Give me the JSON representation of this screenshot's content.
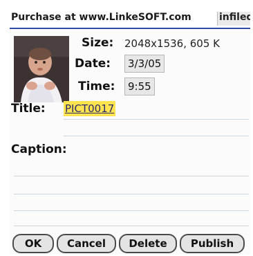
{
  "window": {
    "title": "Purchase at www.LinkeSOFT.com",
    "tab_label": "infiled"
  },
  "photo": {
    "description_icon": "photo-thumbnail"
  },
  "fields": {
    "size_label": "Size:",
    "size_value": "2048x1536, 605 K",
    "date_label": "Date:",
    "date_value": "3/3/05",
    "time_label": "Time:",
    "time_value": "9:55",
    "title_label": "Title:",
    "title_value": "PICT0017",
    "caption_label": "Caption:"
  },
  "buttons": {
    "ok": "OK",
    "cancel": "Cancel",
    "delete": "Delete",
    "publish": "Publish"
  },
  "colors": {
    "title_highlight": "#ffe34f",
    "titlebar_rule": "#2c4aa6"
  }
}
